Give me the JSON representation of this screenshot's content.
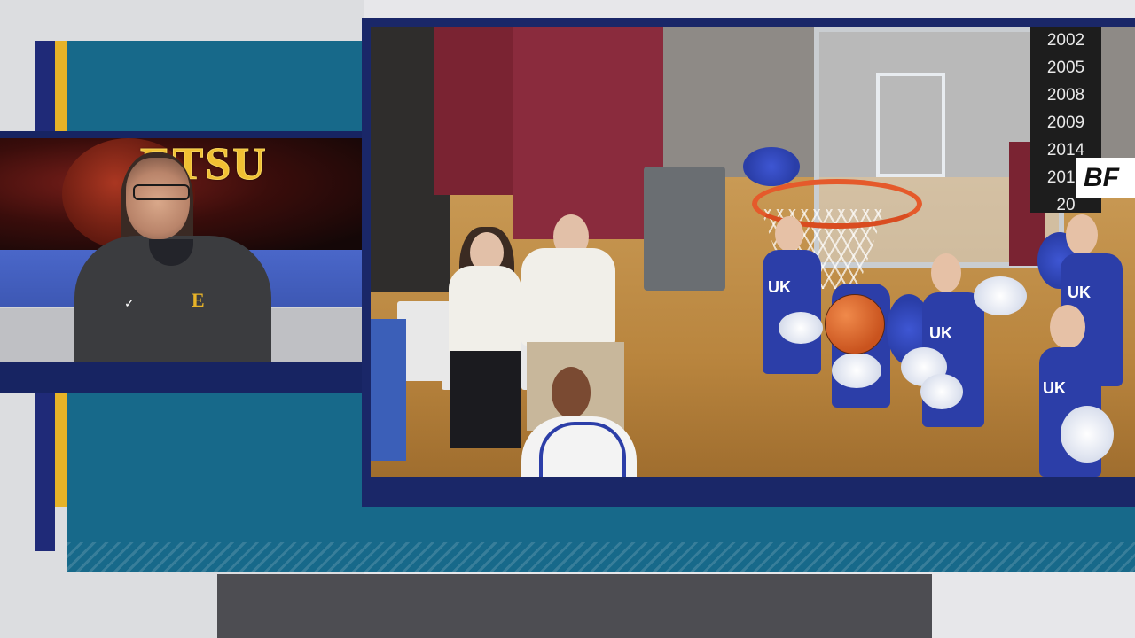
{
  "studio": {
    "logo_text": "ETSU",
    "shirt_logo": "E",
    "shirt_brand_icon": "nike-swoosh-icon"
  },
  "video": {
    "banner_years": [
      "2002",
      "2005",
      "2008",
      "2009",
      "2014",
      "2016",
      "20"
    ],
    "sign_text": "BF",
    "uniform_text": "UK"
  },
  "colors": {
    "navy": "#1f2a78",
    "gold": "#e7b328",
    "teal": "#17698a",
    "frame": "#1a2768"
  }
}
